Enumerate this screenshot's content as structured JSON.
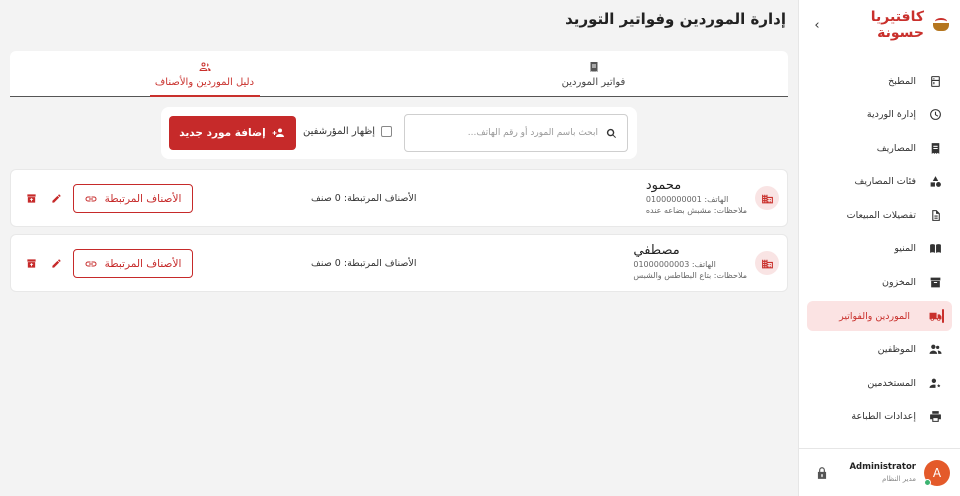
{
  "sidebar": {
    "brand": "كافتيريا حسونة",
    "items": [
      {
        "label": "المطبخ",
        "icon": "kitchen-icon"
      },
      {
        "label": "إدارة الوردية",
        "icon": "shift-icon"
      },
      {
        "label": "المصاريف",
        "icon": "expenses-icon"
      },
      {
        "label": "فئات المصاريف",
        "icon": "categories-icon"
      },
      {
        "label": "تفصيلات المبيعات",
        "icon": "sales-details-icon"
      },
      {
        "label": "المنيو",
        "icon": "menu-book-icon"
      },
      {
        "label": "المخزون",
        "icon": "inventory-icon"
      },
      {
        "label": "الموردين والفواتير",
        "icon": "truck-icon",
        "active": true
      },
      {
        "label": "الموظفين",
        "icon": "people-icon"
      },
      {
        "label": "المستخدمين",
        "icon": "user-settings-icon"
      },
      {
        "label": "إعدادات الطباعة",
        "icon": "printer-icon"
      }
    ],
    "user": {
      "name": "Administrator",
      "role": "مدير النظام",
      "initial": "A"
    }
  },
  "header": {
    "title": "إدارة الموردين وفواتير التوريد"
  },
  "tabs": [
    {
      "label": "فواتير الموردين",
      "icon": "receipt-icon"
    },
    {
      "label": "دليل الموردين والأصناف",
      "icon": "directory-icon",
      "active": true
    }
  ],
  "toolbar": {
    "search_placeholder": "ابحث باسم المورد أو رقم الهاتف...",
    "show_archived": "إظهار المؤرشفين",
    "add_supplier": "إضافة مورد جديد"
  },
  "suppliers": [
    {
      "name": "محمود",
      "phone": "الهاتف: 01000000001",
      "notes": "ملاحظات: مشبش بضاعه عنده",
      "linked_count": "الأصناف المرتبطة: 0 صنف",
      "linked_button": "الأصناف المرتبطة"
    },
    {
      "name": "مصطفي",
      "phone": "الهاتف: 01000000003",
      "notes": "ملاحظات: بتاع البطاطس والشبس",
      "linked_count": "الأصناف المرتبطة: 0 صنف",
      "linked_button": "الأصناف المرتبطة"
    }
  ],
  "colors": {
    "accent": "#c62a2a",
    "active_bg": "#fbe3e3"
  }
}
